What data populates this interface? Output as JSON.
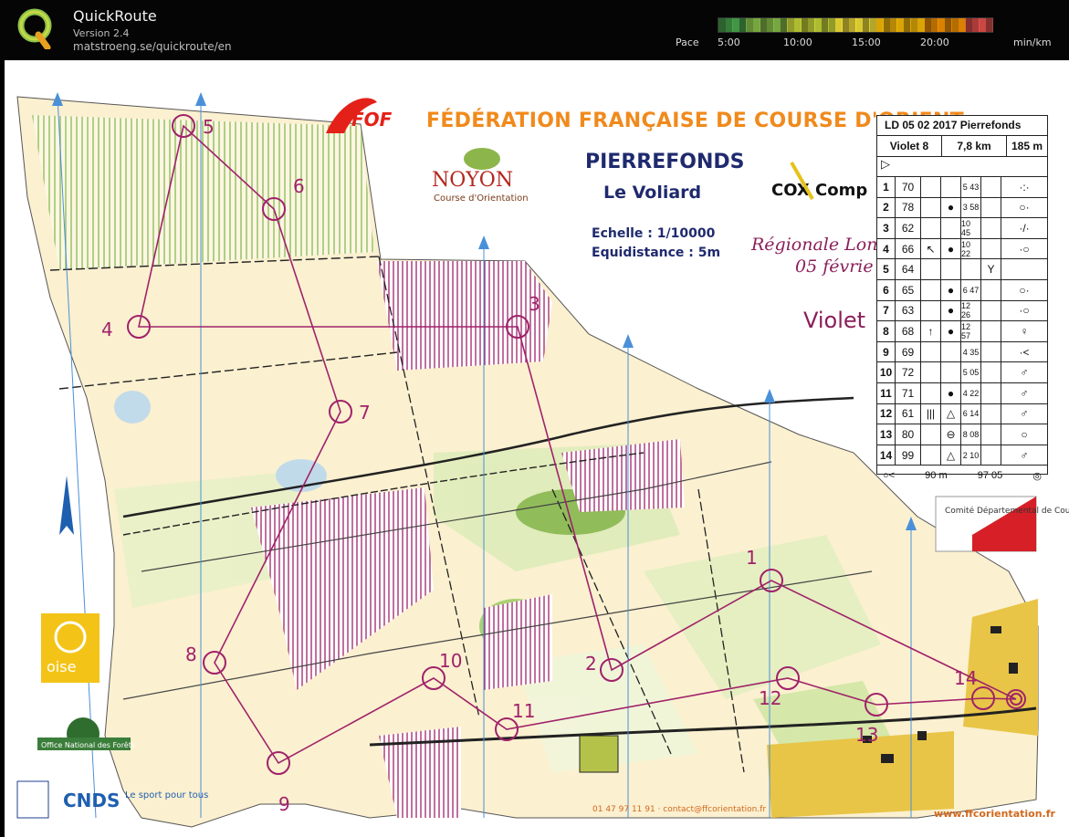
{
  "app": {
    "title": "QuickRoute",
    "version": "Version 2.4",
    "url": "matstroeng.se/quickroute/en"
  },
  "pace": {
    "label": "Pace",
    "ticks": [
      "5:00",
      "10:00",
      "15:00",
      "20:00"
    ],
    "unit": "min/km",
    "colors": [
      "#4caf50",
      "#8bc34a",
      "#cddc39",
      "#ffeb3b",
      "#ffc107",
      "#ff9800",
      "#ef5350"
    ]
  },
  "map": {
    "federation": "FÉDÉRATION FRANÇAISE DE COURSE D'ORIENT",
    "area": "PIERREFONDS",
    "place": "Le Voliard",
    "scale": "Echelle : 1/10000",
    "equidistance": "Equidistance : 5m",
    "event_line1": "Régionale Long",
    "event_line2": "05 févrie",
    "course": "Violet",
    "club_name": "NOYON",
    "club_sub": "Course d'Orientation",
    "sponsor": "COX Comp",
    "ffo_logo": "FOF",
    "contact": "01 47 97 11 91 · contact@ffcorientation.fr",
    "website": "www.ffcorientation.fr",
    "logo_oise": "oise",
    "logo_onf": "Office National des Forêts",
    "logo_cnds": "CNDS",
    "logo_cnds_sub": "Le sport pour tous",
    "committee": "Comité Départemental de Course d'Orientation",
    "controls": [
      "1",
      "2",
      "3",
      "4",
      "5",
      "6",
      "7",
      "8",
      "9",
      "10",
      "11",
      "12",
      "13",
      "14"
    ],
    "accent": "#a0226a"
  },
  "card": {
    "title": "LD 05 02 2017 Pierrefonds",
    "course": "Violet 8",
    "length": "7,8 km",
    "climb": "185 m",
    "start_symbol": "▷",
    "rows": [
      {
        "n": "1",
        "code": "70",
        "a": "",
        "b": "",
        "c": "5 43",
        "d": "",
        "e": "·:·"
      },
      {
        "n": "2",
        "code": "78",
        "a": "",
        "b": "●",
        "c": "3 58",
        "d": "",
        "e": "○·"
      },
      {
        "n": "3",
        "code": "62",
        "a": "",
        "b": "",
        "c": "10 45",
        "d": "",
        "e": "·/·"
      },
      {
        "n": "4",
        "code": "66",
        "a": "↖",
        "b": "●",
        "c": "10 22",
        "d": "",
        "e": "·○"
      },
      {
        "n": "5",
        "code": "64",
        "a": "",
        "b": "",
        "c": "",
        "d": "Y",
        "e": ""
      },
      {
        "n": "6",
        "code": "65",
        "a": "",
        "b": "●",
        "c": "6 47",
        "d": "",
        "e": "○·"
      },
      {
        "n": "7",
        "code": "63",
        "a": "",
        "b": "●",
        "c": "12 26",
        "d": "",
        "e": "·○"
      },
      {
        "n": "8",
        "code": "68",
        "a": "↑",
        "b": "●",
        "c": "12 57",
        "d": "",
        "e": "♀"
      },
      {
        "n": "9",
        "code": "69",
        "a": "",
        "b": "",
        "c": "4 35",
        "d": "",
        "e": "·<"
      },
      {
        "n": "10",
        "code": "72",
        "a": "",
        "b": "",
        "c": "5 05",
        "d": "",
        "e": "♂"
      },
      {
        "n": "11",
        "code": "71",
        "a": "",
        "b": "●",
        "c": "4 22",
        "d": "",
        "e": "♂"
      },
      {
        "n": "12",
        "code": "61",
        "a": "|||",
        "b": "△",
        "c": "6 14",
        "d": "",
        "e": "♂"
      },
      {
        "n": "13",
        "code": "80",
        "a": "",
        "b": "⊖",
        "c": "8 08",
        "d": "",
        "e": "○"
      },
      {
        "n": "14",
        "code": "99",
        "a": "",
        "b": "△",
        "c": "2 10",
        "d": "",
        "e": "♂"
      }
    ],
    "finish": "90 m",
    "finish_time": "97 05"
  }
}
